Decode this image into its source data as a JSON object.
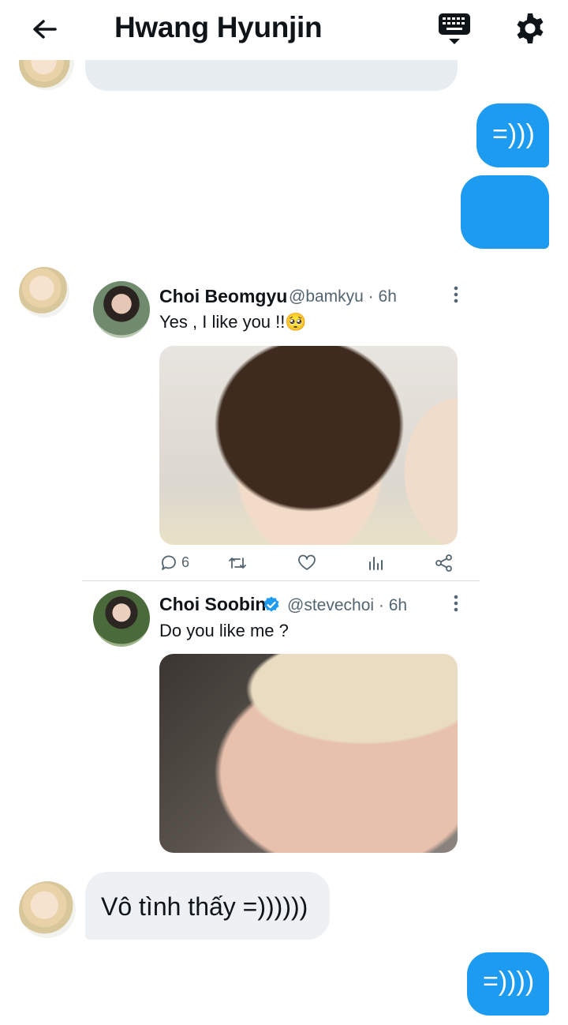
{
  "header": {
    "title": "Hwang Hyunjin",
    "back_icon": "arrow-left-icon",
    "keyboard_icon": "keyboard-icon",
    "settings_icon": "gear-icon"
  },
  "messages": {
    "out1": "=)))",
    "out2": "",
    "in1": "Vô tình thấy =))))))",
    "out3": "=))))"
  },
  "tweet1": {
    "name": "Choi Beomgyu",
    "handle": "@bamkyu · 6h",
    "text": "Yes , I like you !!",
    "emoji": "🥺",
    "reply_count": "6"
  },
  "tweet2": {
    "name": "Choi Soobin",
    "handle": "@stevechoi · 6h",
    "text": "Do you like me ?",
    "verified": true
  },
  "colors": {
    "accent": "#1d9bf0",
    "incoming_bubble": "#eef1f4",
    "handle_gray": "#536471"
  }
}
